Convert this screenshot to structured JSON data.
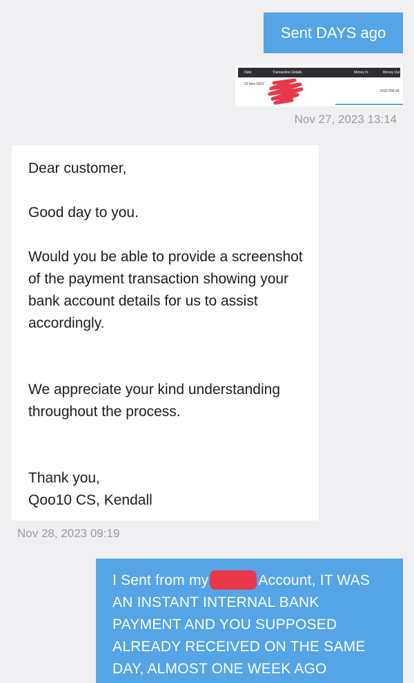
{
  "messages": {
    "sent_1": {
      "text": "Sent DAYS ago"
    },
    "attachment": {
      "header": {
        "date": "Date",
        "details": "Transaction Details",
        "money_in": "Money In",
        "money_out": "Money Out"
      },
      "row_date": "22 Nov 2023",
      "row_amount": "SGD 256.00"
    },
    "timestamp_1": "Nov 27, 2023 13:14",
    "received_1": {
      "greeting": "Dear customer,",
      "line1": "Good day to you.",
      "para1": "Would you be able to provide a screenshot of the payment transaction showing your bank account details for us to assist accordingly.",
      "para2": "We appreciate your kind understanding throughout the process.",
      "signoff": "Thank you,",
      "signature": "Qoo10 CS, Kendall"
    },
    "timestamp_2": "Nov 28, 2023 09:19",
    "sent_2": {
      "text_before": "I Sent from my",
      "text_after": "Account, IT WAS AN INSTANT INTERNAL BANK PAYMENT AND YOU SUPPOSED ALREADY RECEIVED ON THE SAME DAY, ALMOST ONE WEEK AGO"
    }
  },
  "colors": {
    "outgoing_bubble": "#55a4e6",
    "incoming_bubble": "#ffffff",
    "background": "#f0f0f2",
    "timestamp": "#9a9a9e",
    "redaction": "#e8384a"
  }
}
